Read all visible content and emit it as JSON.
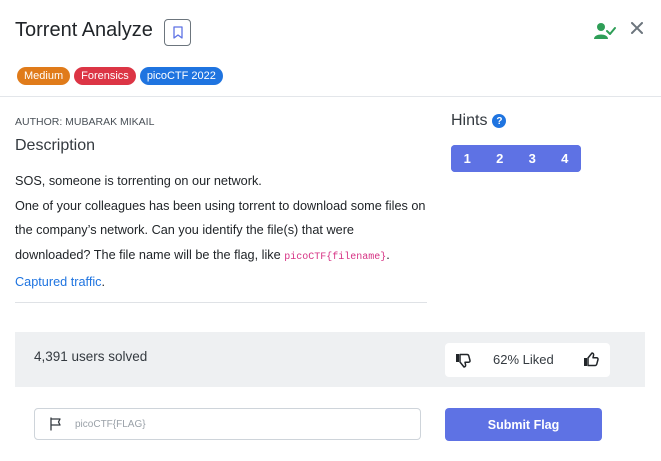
{
  "challenge": {
    "title": "Torrent Analyze",
    "badges": [
      "Medium",
      "Forensics",
      "picoCTF 2022"
    ],
    "author": "AUTHOR: MUBARAK MIKAIL",
    "description_heading": "Description",
    "description": {
      "line1": "SOS, someone is torrenting on our network.",
      "line2_text": "One of your colleagues has been using torrent to download some files on the company’s network. Can you identify the file(s) that were downloaded? The file name will be the flag, like ",
      "flag_format": "picoCTF{filename}",
      "line2_end": ".",
      "link_text": "Captured traffic",
      "link_end": "."
    }
  },
  "hints": {
    "heading": "Hints",
    "help_icon_glyph": "?",
    "buttons": [
      "1",
      "2",
      "3",
      "4"
    ]
  },
  "stats": {
    "solved_text": "4,391 users solved",
    "liked_text": "62% Liked"
  },
  "flag_form": {
    "placeholder": "picoCTF{FLAG}",
    "submit_label": "Submit Flag"
  },
  "icons": {
    "bookmark": "bookmark-icon",
    "user_check": "user-check-icon",
    "close": "close-icon",
    "thumb_down": "thumb-down-icon",
    "thumb_up": "thumb-up-icon",
    "flag": "flag-icon"
  },
  "colors": {
    "accent": "#5e72e4",
    "medium": "#e07b1a",
    "forensics": "#dc3545",
    "event": "#1f74e0",
    "user_check": "#2e9e57"
  }
}
